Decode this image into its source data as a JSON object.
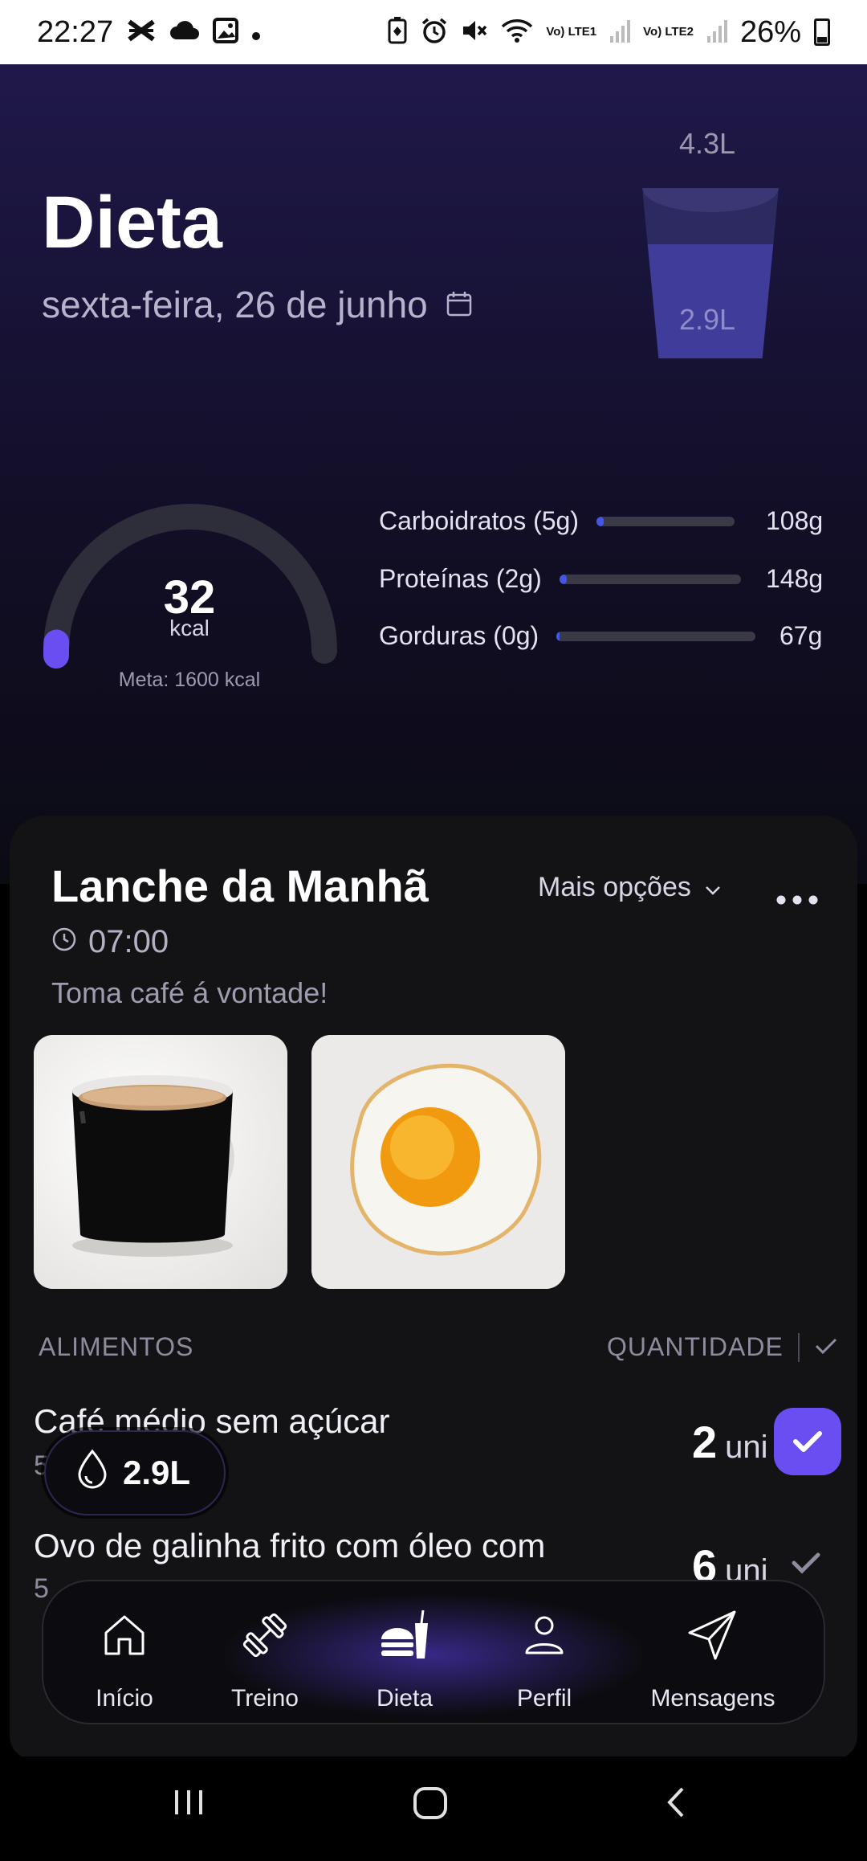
{
  "status_bar": {
    "time": "22:27",
    "battery": "26%",
    "net1": "Vo) LTE1",
    "net2": "Vo) LTE2",
    "icons": [
      "x-mark-icon",
      "cloud-icon",
      "image-icon",
      "dot-icon",
      "battery-saver-icon",
      "alarm-icon",
      "mute-icon",
      "wifi-icon",
      "signal-icon"
    ]
  },
  "header": {
    "title": "Dieta",
    "date": "sexta-feira, 26 de junho",
    "calendar_icon": "calendar-icon"
  },
  "water": {
    "goal": "4.3L",
    "current": "2.9L",
    "fill_fraction": 0.67
  },
  "calories": {
    "value": "32",
    "unit": "kcal",
    "meta": "Meta: 1600 kcal",
    "fraction": 0.02
  },
  "macros": [
    {
      "label": "Carboidratos (5g)",
      "goal": "108g",
      "progress": 0.05
    },
    {
      "label": "Proteínas (2g)",
      "goal": "148g",
      "progress": 0.01
    },
    {
      "label": "Gorduras (0g)",
      "goal": "67g",
      "progress": 0.0
    }
  ],
  "meal": {
    "title": "Lanche da Manhã",
    "more_options": "Mais opções",
    "time": "07:00",
    "note": "Toma café á vontade!",
    "photos": [
      "coffee-cup-photo",
      "fried-egg-photo"
    ],
    "col_foods": "ALIMENTOS",
    "col_qty": "QUANTIDADE",
    "items": [
      {
        "name": "Café médio sem açúcar",
        "sub": "5",
        "qty": "2",
        "unit": "uni",
        "checked": true
      },
      {
        "name": "Ovo de galinha frito com óleo com",
        "sub": "5",
        "qty": "6",
        "unit": "uni",
        "checked": false
      }
    ]
  },
  "water_pill": {
    "value": "2.9L"
  },
  "nav": {
    "items": [
      {
        "label": "Início",
        "icon": "home-icon"
      },
      {
        "label": "Treino",
        "icon": "dumbbell-icon"
      },
      {
        "label": "Dieta",
        "icon": "food-icon"
      },
      {
        "label": "Perfil",
        "icon": "profile-icon"
      },
      {
        "label": "Mensagens",
        "icon": "send-icon"
      }
    ],
    "active": "Dieta"
  },
  "accent": "#6a4ef2"
}
